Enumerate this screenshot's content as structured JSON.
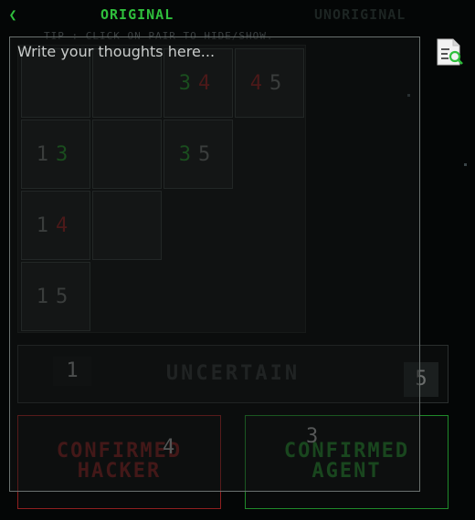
{
  "topbar": {
    "tabs": [
      {
        "label": "ORIGINAL",
        "active": true
      },
      {
        "label": "UNORIGINAL",
        "active": false
      }
    ],
    "tip": "TIP : CLICK ON PAIR TO HIDE/SHOW."
  },
  "icons": {
    "back": "chevron-left-icon",
    "document": "document-search-icon"
  },
  "grid": {
    "rows": [
      [
        {
          "a": "",
          "b": ""
        },
        {
          "a": "",
          "b": ""
        },
        {
          "a": "3",
          "b": "4",
          "color": "green-red"
        },
        {
          "a": "4",
          "b": "5",
          "color": "red-gray"
        }
      ],
      [
        {
          "a": "1",
          "b": "3",
          "color": "gray-green"
        },
        {
          "a": "",
          "b": ""
        },
        {
          "a": "3",
          "b": "5",
          "color": "green-gray"
        }
      ],
      [
        {
          "a": "1",
          "b": "4",
          "color": "gray-red"
        },
        {
          "a": "",
          "b": ""
        }
      ],
      [
        {
          "a": "1",
          "b": "5",
          "color": "gray-gray"
        }
      ]
    ]
  },
  "uncertain": {
    "label": "UNCERTAIN",
    "count": "1",
    "badge": "5"
  },
  "confirm": {
    "hacker": {
      "label_line1": "CONFIRMED",
      "label_line2": "HACKER",
      "count": "4"
    },
    "agent": {
      "label_line1": "CONFIRMED",
      "label_line2": "AGENT",
      "count": "3"
    }
  },
  "notes": {
    "placeholder": "Write your thoughts here..."
  },
  "colors": {
    "accent_green": "#2fbf3c",
    "hacker_red": "#8e1f1f",
    "agent_green": "#1f8a2a",
    "background": "#040606"
  }
}
